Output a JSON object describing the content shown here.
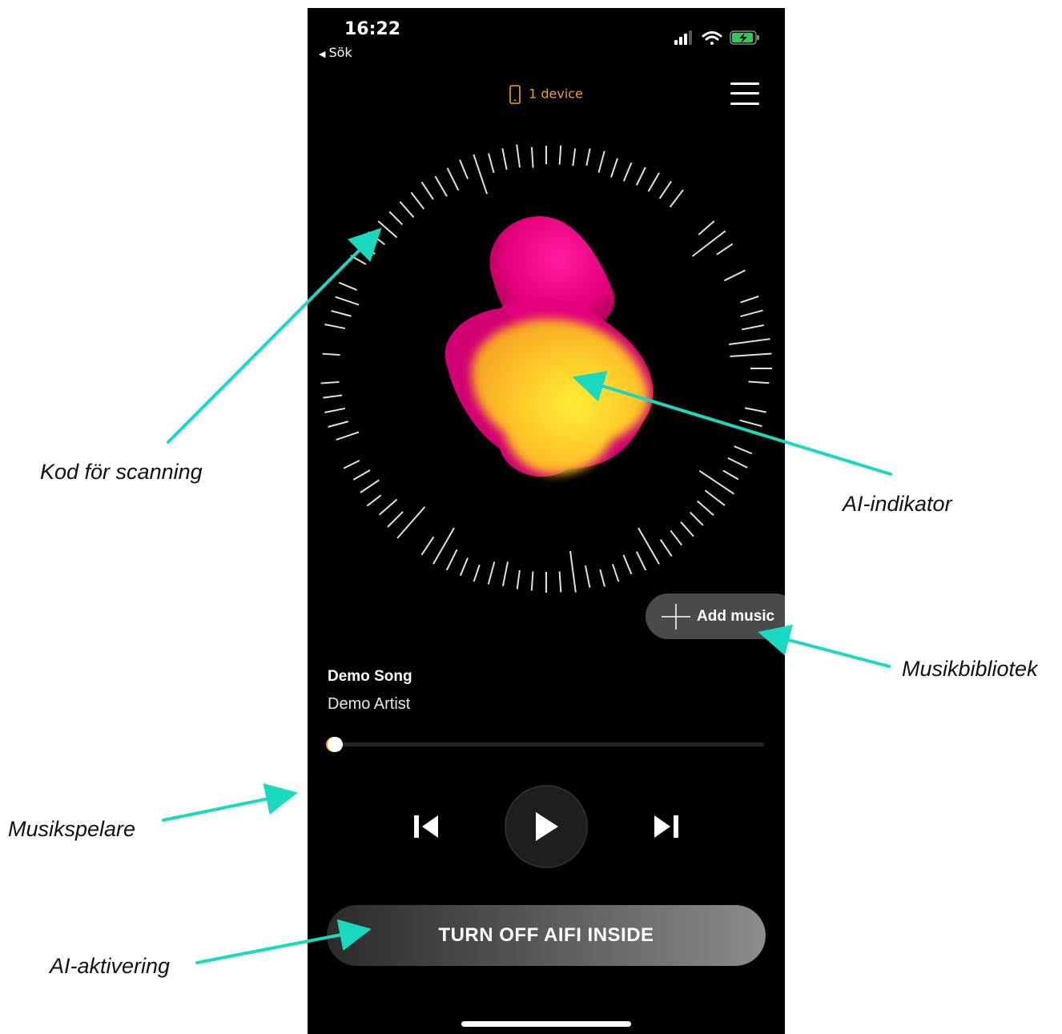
{
  "status_bar": {
    "time": "16:22",
    "back_label": "Sök",
    "icons": [
      "signal-icon",
      "wifi-icon",
      "battery-charging-icon"
    ]
  },
  "header": {
    "device_label": "1 device",
    "device_icon": "phone-icon",
    "menu_icon": "hamburger-menu-icon",
    "accent_color": "#f0a318"
  },
  "ai_indicator": {
    "colors": [
      "#e4007c",
      "#ffd400",
      "#f5a623"
    ]
  },
  "library": {
    "add_music_label": "Add music"
  },
  "player": {
    "song_title": "Demo Song",
    "artist": "Demo Artist",
    "progress": 0.0,
    "controls": [
      "previous-track-icon",
      "play-icon",
      "next-track-icon"
    ]
  },
  "ai_toggle": {
    "label": "TURN OFF AIFI INSIDE"
  },
  "annotations": {
    "scan_code": "Kod för scanning",
    "ai_indicator": "AI-indikator",
    "music_library": "Musikbibliotek",
    "music_player": "Musikspelare",
    "ai_activation": "AI-aktivering",
    "arrow_color": "#1ad9c1"
  }
}
